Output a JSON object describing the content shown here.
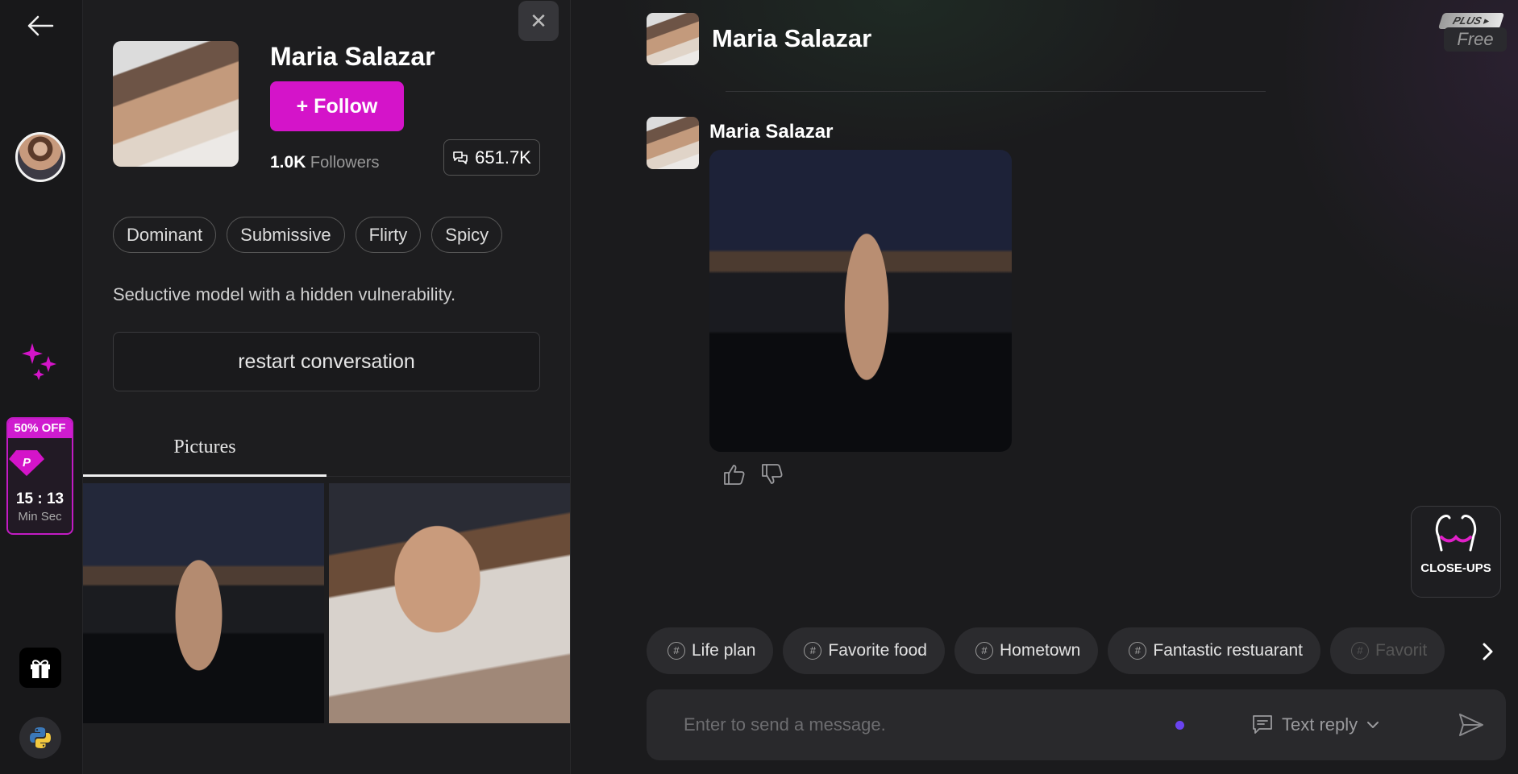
{
  "rail": {
    "promo": {
      "discount": "50% OFF",
      "time": "15 : 13",
      "unit": "Min Sec"
    }
  },
  "profile": {
    "name": "Maria Salazar",
    "follow_label": "+ Follow",
    "followers_count": "1.0K",
    "followers_label": "Followers",
    "messages_count": "651.7K",
    "tags": [
      "Dominant",
      "Submissive",
      "Flirty",
      "Spicy"
    ],
    "description": "Seductive model with a hidden vulnerability.",
    "restart_label": "restart conversation",
    "tab_label": "Pictures"
  },
  "chat": {
    "header_name": "Maria Salazar",
    "plan_badge": "PLUS ▸",
    "plan_label": "Free",
    "message_sender": "Maria Salazar",
    "closeups_label": "CLOSE-UPS",
    "chips": [
      "Life plan",
      "Favorite food",
      "Hometown",
      "Fantastic restuarant",
      "Favorit"
    ],
    "composer": {
      "placeholder": "Enter to send a message.",
      "reply_mode": "Text reply"
    }
  },
  "colors": {
    "accent": "#d414c9",
    "background": "#1b1b1d",
    "indicator": "#6a43f0"
  }
}
